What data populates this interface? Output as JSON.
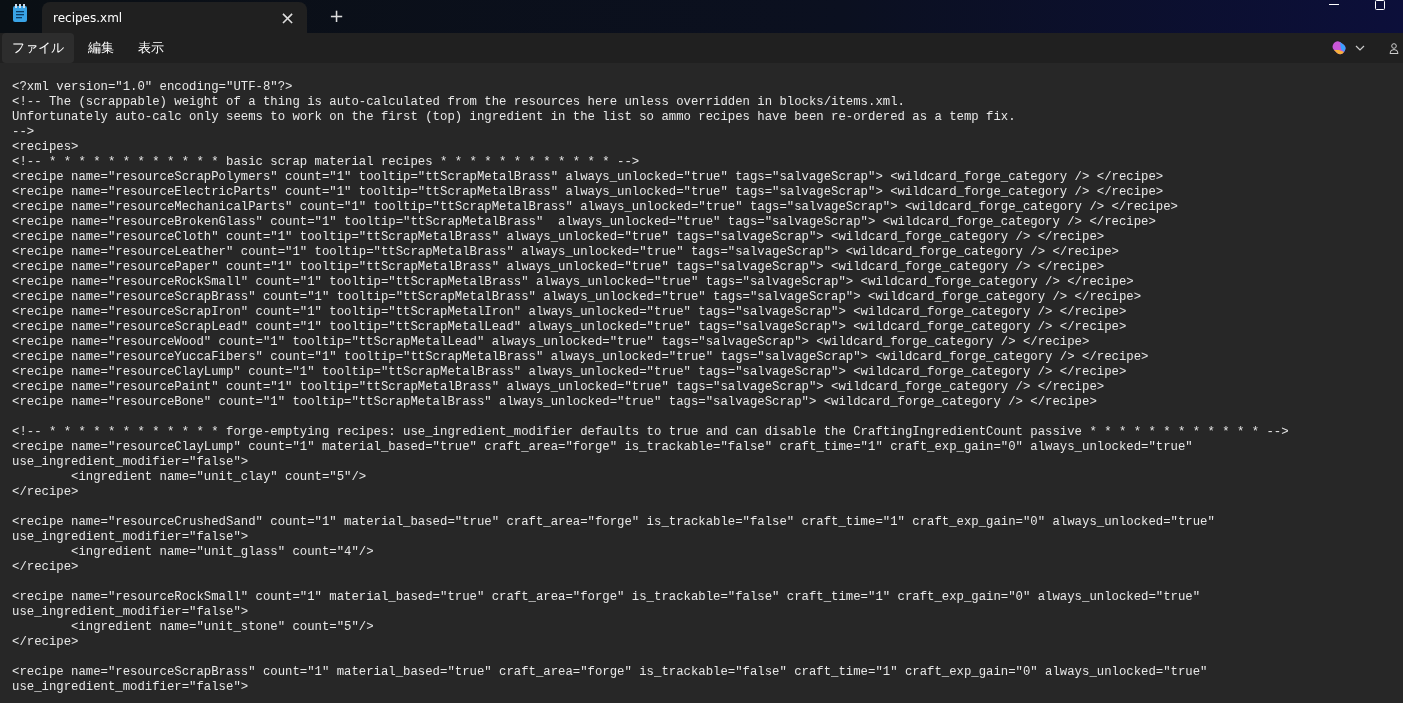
{
  "tabs": [
    {
      "title": "recipes.xml",
      "close": "×",
      "selected": true
    }
  ],
  "new_tab": "+",
  "menu": [
    {
      "label": "ファイル",
      "selected": true
    },
    {
      "label": "編集",
      "selected": false
    },
    {
      "label": "表示",
      "selected": false
    }
  ],
  "editor": {
    "blocks": [
      [
        "<?xml version=\"1.0\" encoding=\"UTF-8\"?>",
        "<!-- The (scrappable) weight of a thing is auto-calculated from the resources here unless overridden in blocks/items.xml.",
        "Unfortunately auto-calc only seems to work on the first (top) ingredient in the list so ammo recipes have been re-ordered as a temp fix.",
        "-->",
        "<recipes>",
        "<!-- * * * * * * * * * * * * basic scrap material recipes * * * * * * * * * * * * -->",
        "<recipe name=\"resourceScrapPolymers\" count=\"1\" tooltip=\"ttScrapMetalBrass\" always_unlocked=\"true\" tags=\"salvageScrap\"> <wildcard_forge_category /> </recipe>",
        "<recipe name=\"resourceElectricParts\" count=\"1\" tooltip=\"ttScrapMetalBrass\" always_unlocked=\"true\" tags=\"salvageScrap\"> <wildcard_forge_category /> </recipe>",
        "<recipe name=\"resourceMechanicalParts\" count=\"1\" tooltip=\"ttScrapMetalBrass\" always_unlocked=\"true\" tags=\"salvageScrap\"> <wildcard_forge_category /> </recipe>",
        "<recipe name=\"resourceBrokenGlass\" count=\"1\" tooltip=\"ttScrapMetalBrass\"  always_unlocked=\"true\" tags=\"salvageScrap\"> <wildcard_forge_category /> </recipe>",
        "<recipe name=\"resourceCloth\" count=\"1\" tooltip=\"ttScrapMetalBrass\" always_unlocked=\"true\" tags=\"salvageScrap\"> <wildcard_forge_category /> </recipe>",
        "<recipe name=\"resourceLeather\" count=\"1\" tooltip=\"ttScrapMetalBrass\" always_unlocked=\"true\" tags=\"salvageScrap\"> <wildcard_forge_category /> </recipe>",
        "<recipe name=\"resourcePaper\" count=\"1\" tooltip=\"ttScrapMetalBrass\" always_unlocked=\"true\" tags=\"salvageScrap\"> <wildcard_forge_category /> </recipe>",
        "<recipe name=\"resourceRockSmall\" count=\"1\" tooltip=\"ttScrapMetalBrass\" always_unlocked=\"true\" tags=\"salvageScrap\"> <wildcard_forge_category /> </recipe>",
        "<recipe name=\"resourceScrapBrass\" count=\"1\" tooltip=\"ttScrapMetalBrass\" always_unlocked=\"true\" tags=\"salvageScrap\"> <wildcard_forge_category /> </recipe>",
        "<recipe name=\"resourceScrapIron\" count=\"1\" tooltip=\"ttScrapMetalIron\" always_unlocked=\"true\" tags=\"salvageScrap\"> <wildcard_forge_category /> </recipe>",
        "<recipe name=\"resourceScrapLead\" count=\"1\" tooltip=\"ttScrapMetalLead\" always_unlocked=\"true\" tags=\"salvageScrap\"> <wildcard_forge_category /> </recipe>",
        "<recipe name=\"resourceWood\" count=\"1\" tooltip=\"ttScrapMetalLead\" always_unlocked=\"true\" tags=\"salvageScrap\"> <wildcard_forge_category /> </recipe>",
        "<recipe name=\"resourceYuccaFibers\" count=\"1\" tooltip=\"ttScrapMetalBrass\" always_unlocked=\"true\" tags=\"salvageScrap\"> <wildcard_forge_category /> </recipe>",
        "<recipe name=\"resourceClayLump\" count=\"1\" tooltip=\"ttScrapMetalBrass\" always_unlocked=\"true\" tags=\"salvageScrap\"> <wildcard_forge_category /> </recipe>",
        "<recipe name=\"resourcePaint\" count=\"1\" tooltip=\"ttScrapMetalBrass\" always_unlocked=\"true\" tags=\"salvageScrap\"> <wildcard_forge_category /> </recipe>",
        "<recipe name=\"resourceBone\" count=\"1\" tooltip=\"ttScrapMetalBrass\" always_unlocked=\"true\" tags=\"salvageScrap\"> <wildcard_forge_category /> </recipe>"
      ],
      [
        "<!-- * * * * * * * * * * * * forge-emptying recipes: use_ingredient_modifier defaults to true and can disable the CraftingIngredientCount passive * * * * * * * * * * * * -->",
        "<recipe name=\"resourceClayLump\" count=\"1\" material_based=\"true\" craft_area=\"forge\" is_trackable=\"false\" craft_time=\"1\" craft_exp_gain=\"0\" always_unlocked=\"true\"",
        "use_ingredient_modifier=\"false\">",
        "        <ingredient name=\"unit_clay\" count=\"5\"/>",
        "</recipe>"
      ],
      [
        "<recipe name=\"resourceCrushedSand\" count=\"1\" material_based=\"true\" craft_area=\"forge\" is_trackable=\"false\" craft_time=\"1\" craft_exp_gain=\"0\" always_unlocked=\"true\"",
        "use_ingredient_modifier=\"false\">",
        "        <ingredient name=\"unit_glass\" count=\"4\"/>",
        "</recipe>"
      ],
      [
        "<recipe name=\"resourceRockSmall\" count=\"1\" material_based=\"true\" craft_area=\"forge\" is_trackable=\"false\" craft_time=\"1\" craft_exp_gain=\"0\" always_unlocked=\"true\"",
        "use_ingredient_modifier=\"false\">",
        "        <ingredient name=\"unit_stone\" count=\"5\"/>",
        "</recipe>"
      ],
      [
        "<recipe name=\"resourceScrapBrass\" count=\"1\" material_based=\"true\" craft_area=\"forge\" is_trackable=\"false\" craft_time=\"1\" craft_exp_gain=\"0\" always_unlocked=\"true\"",
        "use_ingredient_modifier=\"false\">"
      ]
    ]
  }
}
